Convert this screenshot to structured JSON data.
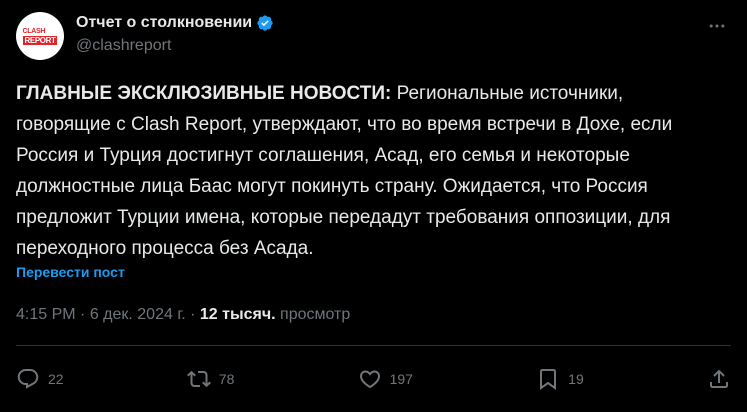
{
  "author": {
    "name": "Отчет о столкновении",
    "handle": "@clashreport",
    "avatar_text_top": "CLASH",
    "avatar_text_bottom": "REPORT"
  },
  "tweet": {
    "headline": "ГЛАВНЫЕ ЭКСКЛЮЗИВНЫЕ НОВОСТИ:",
    "body": " Региональные источники, говорящие с Clash Report, утверждают, что во время встречи в Дохе, если Россия и Турция достигнут соглашения, Асад, его семья и некоторые должностные лица Баас могут покинуть страну. Ожидается, что Россия предложит Турции имена, которые передадут требования оппозиции, для переходного процесса без Асада.",
    "translate_label": "Перевести пост"
  },
  "meta": {
    "time": "4:15 PM",
    "sep1": " · ",
    "date": "6 дек. 2024 г.",
    "sep2": " · ",
    "views_count": "12 тысяч.",
    "views_label": " просмотр"
  },
  "actions": {
    "replies": "22",
    "reposts": "78",
    "likes": "197",
    "bookmarks": "19"
  },
  "colors": {
    "background": "#000000",
    "text": "#e7e9ea",
    "muted": "#71767b",
    "accent": "#1d9bf0",
    "brand": "#e0242b"
  }
}
